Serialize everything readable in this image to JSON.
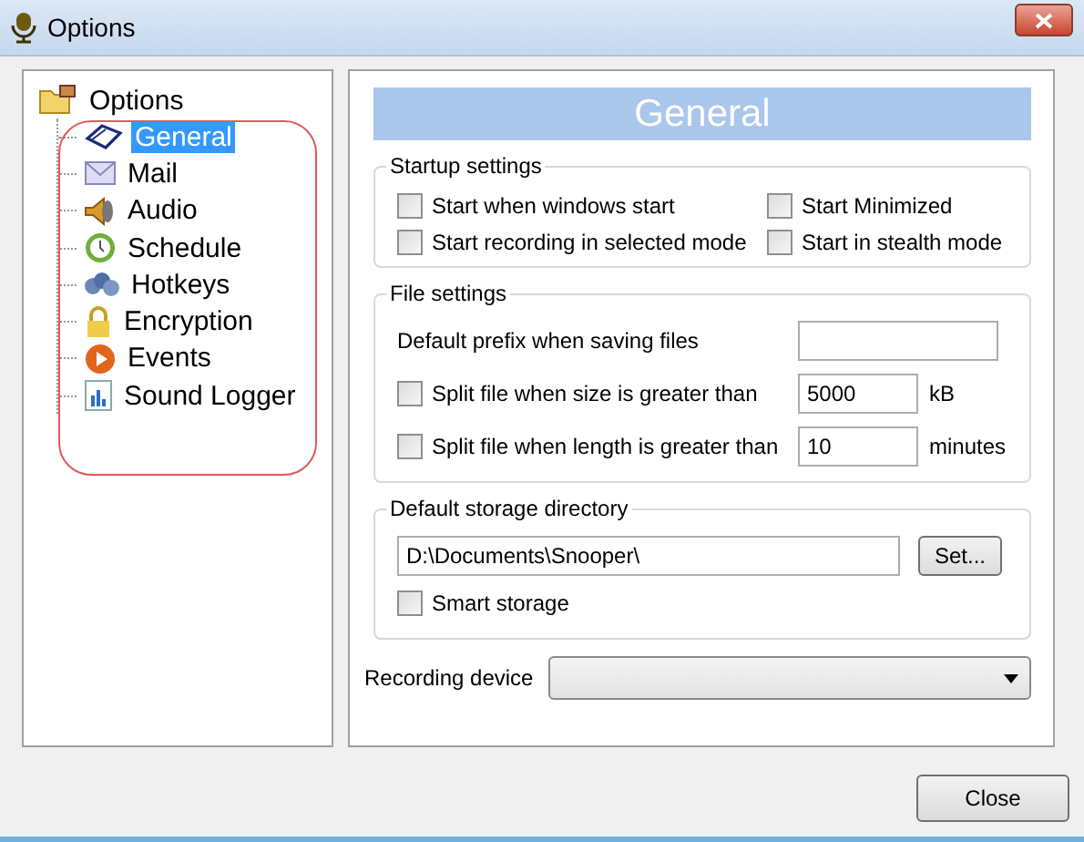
{
  "window": {
    "title": "Options"
  },
  "tree": [
    {
      "label": "Options",
      "expanded": true,
      "children": [
        {
          "label": "General",
          "selected": true
        },
        {
          "label": "Mail",
          "selected": false
        },
        {
          "label": "Audio",
          "selected": false
        },
        {
          "label": "Schedule",
          "selected": false
        },
        {
          "label": "Hotkeys",
          "selected": false
        },
        {
          "label": "Encryption",
          "selected": false
        },
        {
          "label": "Events",
          "selected": false
        },
        {
          "label": "Sound Logger",
          "selected": false
        }
      ]
    }
  ],
  "page_title": "General",
  "startup_settings": {
    "title": "Startup settings",
    "options": [
      {
        "label": "Start when windows start",
        "checked": false
      },
      {
        "label": "Start Minimized",
        "checked": false
      },
      {
        "label": "Start recording in selected mode",
        "checked": false
      },
      {
        "label": "Start in stealth mode",
        "checked": false
      }
    ]
  },
  "file_settings": {
    "title": "File settings",
    "prefix_label": "Default prefix when saving files",
    "rows": [
      {
        "label": "Split file when size is greater than",
        "checked": false,
        "value": "5000",
        "unit": "kB"
      },
      {
        "label": "Split file when length is greater than",
        "checked": false,
        "value": "10",
        "unit": "minutes"
      }
    ]
  },
  "storage": {
    "title": "Default storage directory",
    "path": "D:\\Documents\\Snooper\\",
    "set_button": "Set...",
    "smart_storage": {
      "label": "Smart storage",
      "checked": false
    }
  },
  "recording_device": {
    "label": "Recording device"
  },
  "buttons": [
    "Close"
  ]
}
